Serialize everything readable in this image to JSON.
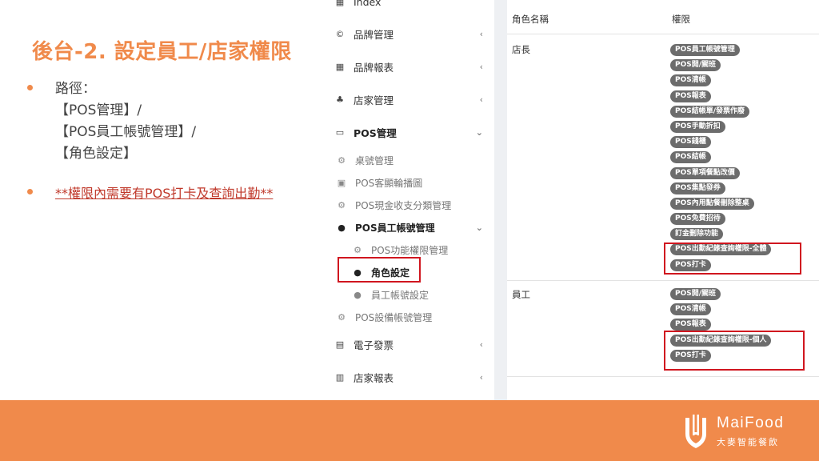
{
  "slide": {
    "title": "後台-2. 設定員工/店家權限",
    "bullets": [
      {
        "lines": [
          "路徑：",
          "【POS管理】/",
          "【POS員工帳號管理】/",
          "【角色設定】"
        ]
      },
      {
        "text": "**權限內需要有POS打卡及查詢出勤**"
      }
    ]
  },
  "sidebar": {
    "items": [
      {
        "label": "Index",
        "icon": "dashboard-icon"
      },
      {
        "label": "品牌管理",
        "icon": "copyright-icon"
      },
      {
        "label": "品牌報表",
        "icon": "table-icon"
      },
      {
        "label": "店家管理",
        "icon": "sitemap-icon"
      },
      {
        "label": "POS管理",
        "icon": "monitor-icon"
      },
      {
        "label": "電子發票",
        "icon": "invoice-icon"
      },
      {
        "label": "店家報表",
        "icon": "bar-chart-icon"
      }
    ],
    "pos_sub": [
      {
        "label": "桌號管理",
        "icon": "gear-icon"
      },
      {
        "label": "POS客顯輪播圖",
        "icon": "image-icon"
      },
      {
        "label": "POS現金收支分類管理",
        "icon": "gear-icon"
      },
      {
        "label": "POS員工帳號管理",
        "icon": "user-icon"
      },
      {
        "label": "POS功能權限管理",
        "icon": "gear-icon"
      },
      {
        "label": "角色設定",
        "icon": "user-icon"
      },
      {
        "label": "員工帳號設定",
        "icon": "user-icon"
      },
      {
        "label": "POS設備帳號管理",
        "icon": "gear-icon"
      }
    ]
  },
  "table": {
    "headers": [
      "角色名稱",
      "權限"
    ],
    "rows": [
      {
        "role": "店長",
        "permissions": [
          "POS員工帳號管理",
          "POS開/關班",
          "POS清帳",
          "POS報表",
          "POS結帳單/發票作廢",
          "POS手動折扣",
          "POS錢櫃",
          "POS結帳",
          "POS單項餐點改價",
          "POS集點發券",
          "POS內用點餐刪除整桌",
          "POS免費招待",
          "訂金刪除功能",
          "POS出勤紀錄查詢權限-全體",
          "POS打卡"
        ]
      },
      {
        "role": "員工",
        "permissions": [
          "POS開/關班",
          "POS清帳",
          "POS報表",
          "POS出勤紀錄查詢權限-個人",
          "POS打卡"
        ]
      }
    ]
  },
  "brand": {
    "name": "MaiFood",
    "subtitle": "大麥智能餐飲",
    "colors": {
      "accent": "#f08a4b",
      "highlight": "#d0161f",
      "badge": "#6c6c6c"
    }
  }
}
